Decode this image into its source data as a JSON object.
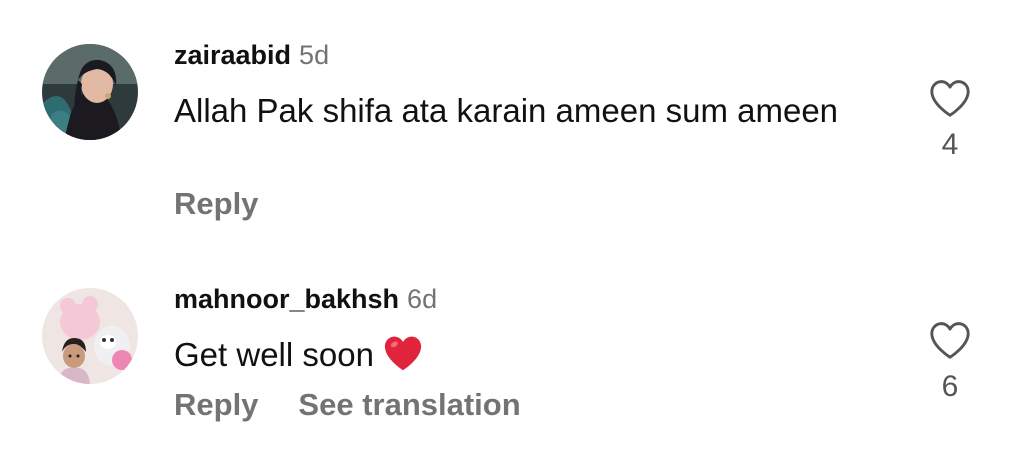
{
  "comments": [
    {
      "username": "zairaabid",
      "time": "5d",
      "text": "Allah Pak shifa ata karain ameen sum ameen",
      "emoji": "",
      "actions": [
        "Reply"
      ],
      "likes": "4",
      "avatar_icon": "profile-photo-woman-headscarf",
      "like_icon": "heart-outline-icon"
    },
    {
      "username": "mahnoor_bakhsh",
      "time": "6d",
      "text": "Get well soon",
      "emoji": "red-heart-emoji",
      "actions": [
        "Reply",
        "See translation"
      ],
      "likes": "6",
      "avatar_icon": "profile-photo-child-with-plush-toys",
      "like_icon": "heart-outline-icon"
    }
  ],
  "colors": {
    "text_primary": "#111111",
    "text_secondary": "#737373",
    "heart_emoji": "#e0243b"
  }
}
